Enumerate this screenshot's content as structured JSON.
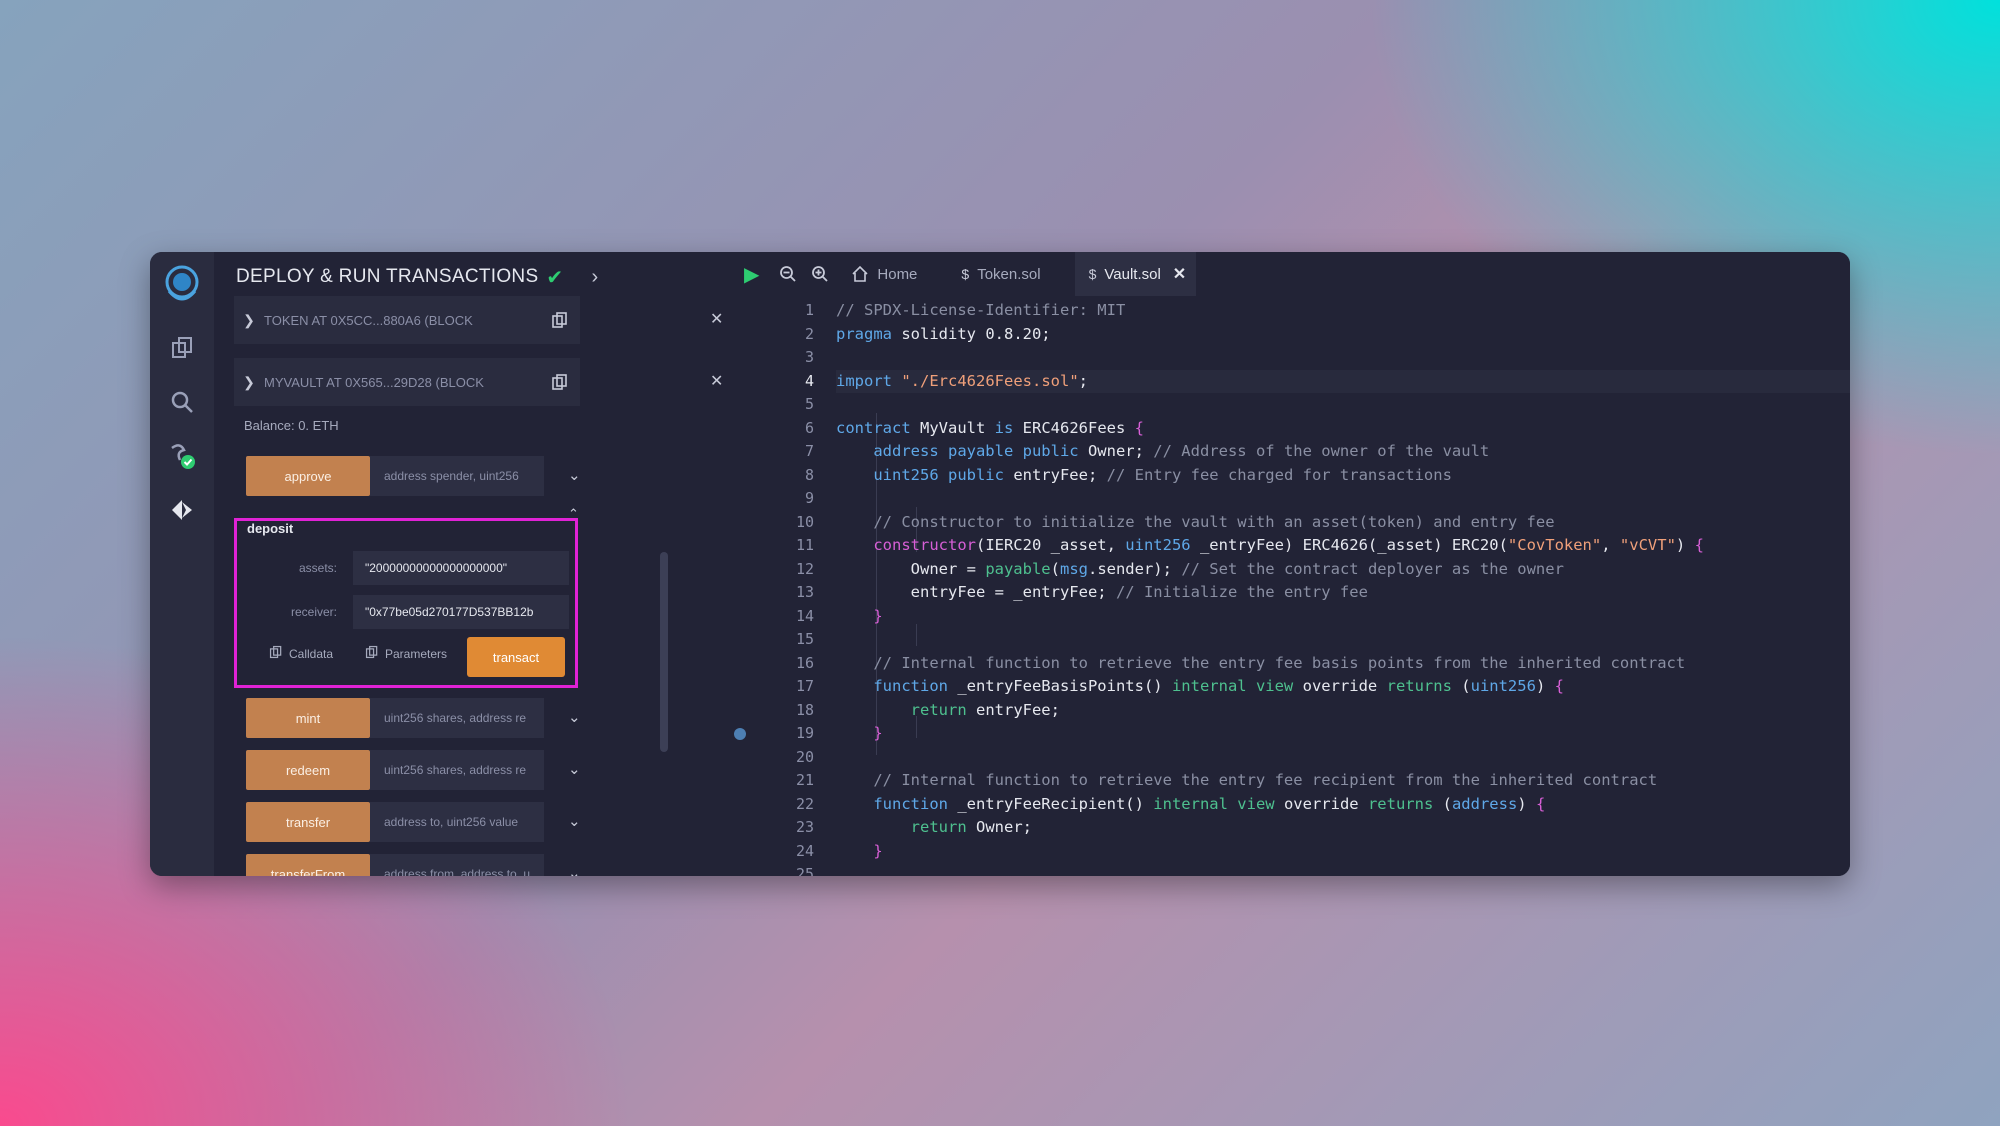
{
  "plugin": {
    "title": "DEPLOY & RUN TRANSACTIONS",
    "instances": [
      {
        "label": "TOKEN AT 0X5CC...880A6 (BLOCK",
        "expanded": false
      },
      {
        "label": "MYVAULT AT 0X565...29D28 (BLOCK",
        "expanded": true
      }
    ],
    "balance": "Balance: 0. ETH",
    "functions": [
      {
        "name": "approve",
        "placeholder": "address spender, uint256"
      },
      {
        "name": "mint",
        "placeholder": "uint256 shares, address re"
      },
      {
        "name": "redeem",
        "placeholder": "uint256 shares, address re"
      },
      {
        "name": "transfer",
        "placeholder": "address to, uint256 value"
      },
      {
        "name": "transferFrom",
        "placeholder": "address from, address to, u"
      }
    ],
    "deposit": {
      "title": "deposit",
      "params": [
        {
          "label": "assets:",
          "value": "\"20000000000000000000\""
        },
        {
          "label": "receiver:",
          "value": "\"0x77be05d270177D537BB12b"
        }
      ],
      "calldata_label": "Calldata",
      "parameters_label": "Parameters",
      "transact_label": "transact"
    }
  },
  "editor": {
    "tabs": [
      {
        "label": "Home",
        "icon": "home-icon"
      },
      {
        "label": "Token.sol",
        "icon": "solidity-icon"
      },
      {
        "label": "Vault.sol",
        "icon": "solidity-icon",
        "active": true
      }
    ],
    "current_line": 4,
    "breakpoint_line": 19,
    "lines": [
      [
        [
          "tk-comment",
          "// SPDX-License-Identifier: MIT"
        ]
      ],
      [
        [
          "tk-kw",
          "pragma"
        ],
        [
          "tk-id",
          " solidity 0.8.20;"
        ]
      ],
      [],
      [
        [
          "tk-kw",
          "import"
        ],
        [
          "tk-id",
          " "
        ],
        [
          "tk-str",
          "\"./Erc4626Fees.sol\""
        ],
        [
          "tk-id",
          ";"
        ]
      ],
      [],
      [
        [
          "tk-kw",
          "contract"
        ],
        [
          "tk-id",
          " MyVault "
        ],
        [
          "tk-kw",
          "is"
        ],
        [
          "tk-id",
          " ERC4626Fees "
        ],
        [
          "tk-brace",
          "{"
        ]
      ],
      [
        [
          "tk-id",
          "    "
        ],
        [
          "tk-type",
          "address payable public"
        ],
        [
          "tk-id",
          " Owner; "
        ],
        [
          "tk-comment",
          "// Address of the owner of the vault"
        ]
      ],
      [
        [
          "tk-id",
          "    "
        ],
        [
          "tk-type",
          "uint256 public"
        ],
        [
          "tk-id",
          " entryFee; "
        ],
        [
          "tk-comment",
          "// Entry fee charged for transactions"
        ]
      ],
      [],
      [
        [
          "tk-id",
          "    "
        ],
        [
          "tk-comment",
          "// Constructor to initialize the vault with an asset(token) and entry fee"
        ]
      ],
      [
        [
          "tk-id",
          "    "
        ],
        [
          "tk-brace",
          "constructor"
        ],
        [
          "tk-id",
          "(IERC20 _asset, "
        ],
        [
          "tk-type",
          "uint256"
        ],
        [
          "tk-id",
          " _entryFee) ERC4626(_asset) ERC20("
        ],
        [
          "tk-str",
          "\"CovToken\""
        ],
        [
          "tk-id",
          ", "
        ],
        [
          "tk-str",
          "\"vCVT\""
        ],
        [
          "tk-id",
          ") "
        ],
        [
          "tk-brace",
          "{"
        ]
      ],
      [
        [
          "tk-id",
          "        Owner = "
        ],
        [
          "tk-kw2",
          "payable"
        ],
        [
          "tk-id",
          "("
        ],
        [
          "tk-msg",
          "msg"
        ],
        [
          "tk-id",
          ".sender); "
        ],
        [
          "tk-comment",
          "// Set the contract deployer as the owner"
        ]
      ],
      [
        [
          "tk-id",
          "        entryFee = _entryFee; "
        ],
        [
          "tk-comment",
          "// Initialize the entry fee"
        ]
      ],
      [
        [
          "tk-id",
          "    "
        ],
        [
          "tk-brace",
          "}"
        ]
      ],
      [],
      [
        [
          "tk-id",
          "    "
        ],
        [
          "tk-comment",
          "// Internal function to retrieve the entry fee basis points from the inherited contract"
        ]
      ],
      [
        [
          "tk-id",
          "    "
        ],
        [
          "tk-kw",
          "function"
        ],
        [
          "tk-id",
          " _entryFeeBasisPoints() "
        ],
        [
          "tk-kw2",
          "internal view"
        ],
        [
          "tk-id",
          " override "
        ],
        [
          "tk-kw2",
          "returns"
        ],
        [
          "tk-id",
          " ("
        ],
        [
          "tk-type",
          "uint256"
        ],
        [
          "tk-id",
          ") "
        ],
        [
          "tk-brace",
          "{"
        ]
      ],
      [
        [
          "tk-id",
          "        "
        ],
        [
          "tk-ret",
          "return"
        ],
        [
          "tk-id",
          " entryFee;"
        ]
      ],
      [
        [
          "tk-id",
          "    "
        ],
        [
          "tk-brace",
          "}"
        ]
      ],
      [],
      [
        [
          "tk-id",
          "    "
        ],
        [
          "tk-comment",
          "// Internal function to retrieve the entry fee recipient from the inherited contract"
        ]
      ],
      [
        [
          "tk-id",
          "    "
        ],
        [
          "tk-kw",
          "function"
        ],
        [
          "tk-id",
          " _entryFeeRecipient() "
        ],
        [
          "tk-kw2",
          "internal view"
        ],
        [
          "tk-id",
          " override "
        ],
        [
          "tk-kw2",
          "returns"
        ],
        [
          "tk-id",
          " ("
        ],
        [
          "tk-type",
          "address"
        ],
        [
          "tk-id",
          ") "
        ],
        [
          "tk-brace",
          "{"
        ]
      ],
      [
        [
          "tk-id",
          "        "
        ],
        [
          "tk-ret",
          "return"
        ],
        [
          "tk-id",
          " Owner;"
        ]
      ],
      [
        [
          "tk-id",
          "    "
        ],
        [
          "tk-brace",
          "}"
        ]
      ],
      []
    ]
  },
  "colors": {
    "accent_orange": "#e08a34",
    "fn_button": "#c2814f",
    "highlight_border": "#e022d6",
    "check_green": "#2ecc71"
  }
}
